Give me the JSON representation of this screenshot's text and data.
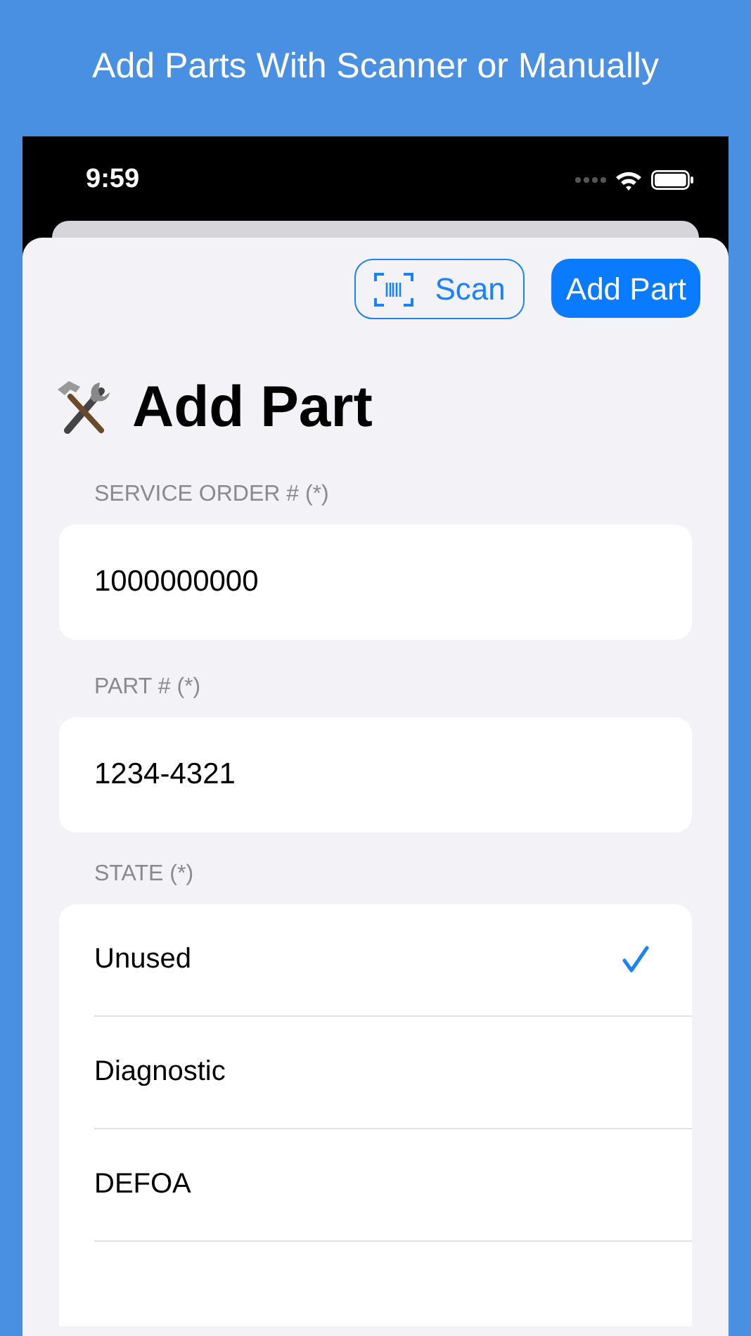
{
  "headline": "Add Parts With Scanner or Manually",
  "status_bar": {
    "time": "9:59"
  },
  "toolbar": {
    "scan_button": "Scan",
    "add_button": "Add Part"
  },
  "title": "Add Part",
  "fields": [
    {
      "label": "SERVICE ORDER # (*)",
      "value": "1000000000"
    },
    {
      "label": "PART # (*)",
      "value": "1234-4321"
    }
  ],
  "state": {
    "label": "STATE (*)",
    "options": [
      {
        "label": "Unused",
        "selected": true
      },
      {
        "label": "Diagnostic",
        "selected": false
      },
      {
        "label": "DEFOA",
        "selected": false
      }
    ]
  }
}
